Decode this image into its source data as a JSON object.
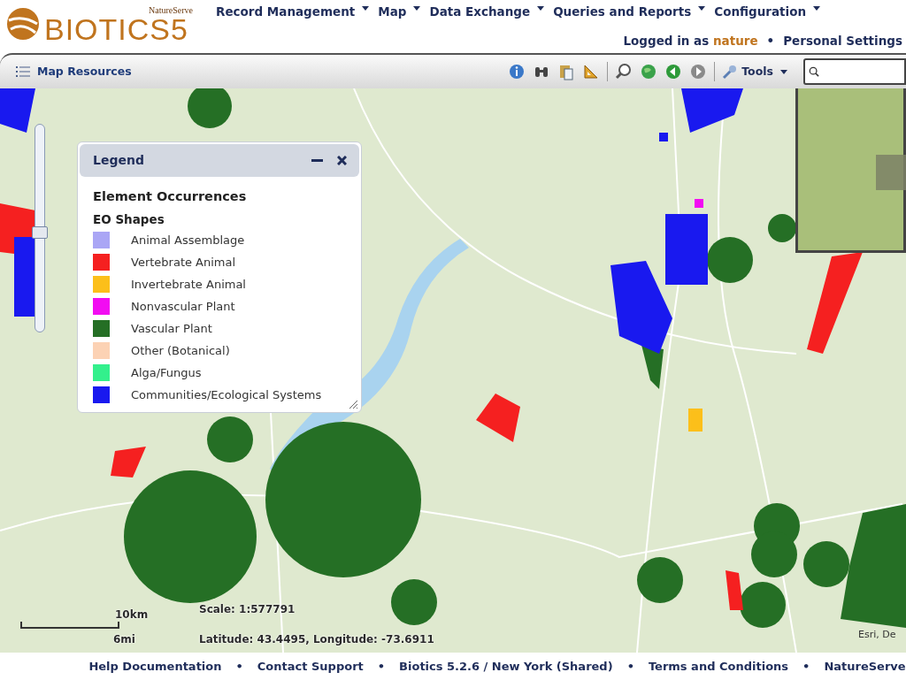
{
  "header": {
    "logo_brand": "NatureServe",
    "logo_name": "BIOTICS",
    "logo_version": "5",
    "menu": [
      {
        "label": "Record Management"
      },
      {
        "label": "Map"
      },
      {
        "label": "Data Exchange"
      },
      {
        "label": "Queries and Reports"
      },
      {
        "label": "Configuration"
      }
    ],
    "login_prefix": "Logged in as",
    "user": "nature",
    "separator": "•",
    "settings": "Personal Settings"
  },
  "toolbar": {
    "resources": "Map Resources",
    "tools": "Tools"
  },
  "zoom_slider": {
    "level": 0.48
  },
  "legend": {
    "title": "Legend",
    "heading": "Element Occurrences",
    "subheading": "EO Shapes",
    "items": [
      {
        "label": "Animal Assemblage",
        "color": "#aaa6f5"
      },
      {
        "label": "Vertebrate Animal",
        "color": "#f52020"
      },
      {
        "label": "Invertebrate Animal",
        "color": "#fcbf1a"
      },
      {
        "label": "Nonvascular Plant",
        "color": "#f20cf2"
      },
      {
        "label": "Vascular Plant",
        "color": "#256f25"
      },
      {
        "label": "Other (Botanical)",
        "color": "#fcd2b4"
      },
      {
        "label": "Alga/Fungus",
        "color": "#33f08c"
      },
      {
        "label": "Communities/Ecological Systems",
        "color": "#1919ef"
      }
    ]
  },
  "map": {
    "scale": "Scale: 1:577791",
    "scale_bar_km": "10km",
    "scale_bar_mi": "6mi",
    "coordinates": "Latitude: 43.4495, Longitude: -73.6911",
    "attribution": "Esri, De"
  },
  "footer": {
    "separator": "•",
    "links": [
      "Help Documentation",
      "Contact Support",
      "Biotics 5.2.6 / New York (Shared)",
      "Terms and Conditions",
      "NatureServe"
    ]
  }
}
